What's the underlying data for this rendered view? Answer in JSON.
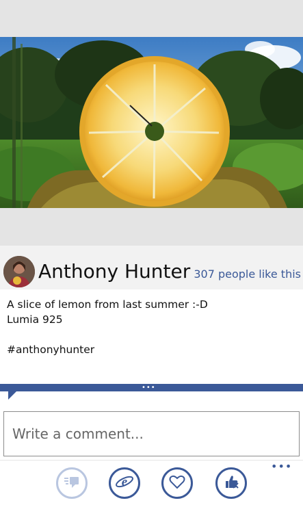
{
  "author": {
    "name": "Anthony Hunter",
    "likes_text": "307 people like this"
  },
  "post": {
    "caption_lines": [
      "A slice of lemon from last summer :-D",
      "Lumia 925",
      "",
      "#anthonyhunter"
    ]
  },
  "comment": {
    "placeholder": "Write a comment..."
  },
  "app_bar": {
    "buttons": [
      {
        "name": "comments-icon",
        "enabled": false
      },
      {
        "name": "internet-explorer-icon",
        "enabled": true
      },
      {
        "name": "heart-icon",
        "enabled": true
      },
      {
        "name": "unlike-icon",
        "enabled": true
      }
    ],
    "more_label": "•••"
  },
  "divider_label": "•••",
  "colors": {
    "accent": "#3b5998",
    "accent_disabled": "#b9c6e0",
    "page_background": "#ffffff",
    "photo_frame": "#e4e4e4",
    "author_bar": "#f2f2f2"
  }
}
